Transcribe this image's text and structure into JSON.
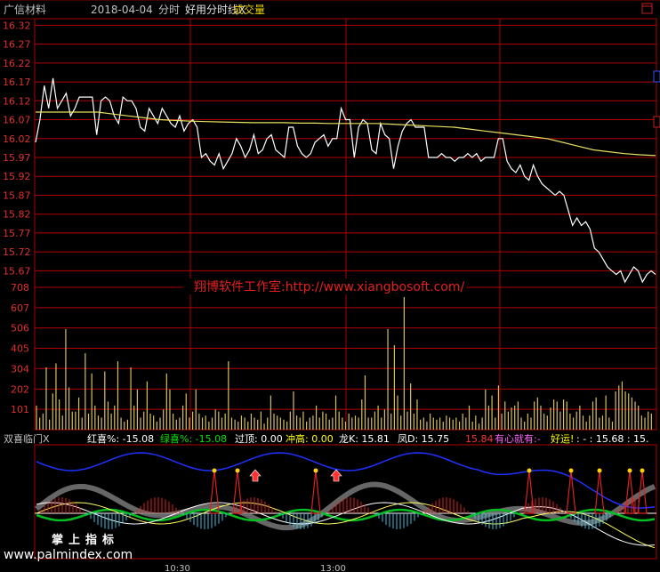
{
  "header": {
    "stock": "广信材料",
    "date": "2018-04-04",
    "mode": "分时",
    "indicator": "好用分时线X",
    "volume": "成交量"
  },
  "watermark": "翔博软件工作室:http://www.xiangbosoft.com/",
  "legend": {
    "title": "双喜临门X",
    "hongxi": "红喜%: -15.08",
    "lvxi": "绿喜%: -15.08",
    "guoding": "过顶: 0.00",
    "chonggao": "冲高: 0.00",
    "long": "龙K: 15.81",
    "feng": "凤D: 15.75",
    "red_value": "15.84",
    "youxin": "有心就有:-",
    "haoyun": "好运!",
    "tail": ": - : 15.68 : 15."
  },
  "footer": {
    "logo": "掌上指标",
    "site": "www.palmindex.com",
    "time1": "10:30",
    "time2": "13:00"
  },
  "colors": {
    "grid": "#b00000",
    "price_line": "#ffffff",
    "avg_line": "#e8e060",
    "volume_bar": "#d8c060",
    "axis_text": "#e03030",
    "indicator_blue": "#2030ff",
    "indicator_green": "#00c020",
    "indicator_red": "#e02020"
  },
  "chart_data": {
    "type": "line",
    "y_ticks": [
      "16.32",
      "16.27",
      "16.22",
      "16.17",
      "16.12",
      "16.07",
      "16.02",
      "15.97",
      "15.92",
      "15.87",
      "15.82",
      "15.77",
      "15.72",
      "15.67"
    ],
    "ylim": [
      15.645,
      16.335
    ],
    "volume_ticks": [
      "708",
      "607",
      "506",
      "405",
      "304",
      "202",
      "101"
    ],
    "volume_ylim": [
      0,
      708
    ],
    "price_series": [
      {
        "name": "price",
        "values": [
          16.01,
          16.07,
          16.16,
          16.1,
          16.18,
          16.1,
          16.12,
          16.14,
          16.08,
          16.1,
          16.13,
          16.13,
          16.13,
          16.13,
          16.03,
          16.12,
          16.13,
          16.12,
          16.08,
          16.06,
          16.13,
          16.12,
          16.12,
          16.1,
          16.05,
          16.04,
          16.1,
          16.08,
          16.06,
          16.1,
          16.08,
          16.06,
          16.05,
          16.08,
          16.04,
          16.06,
          16.07,
          16.05,
          15.97,
          15.98,
          15.96,
          15.95,
          15.98,
          15.94,
          15.96,
          15.98,
          16.02,
          16.0,
          15.97,
          15.99,
          16.03,
          15.98,
          15.99,
          16.02,
          16.03,
          15.99,
          15.98,
          15.97,
          16.05,
          16.05,
          16.0,
          15.98,
          15.97,
          15.98,
          16.01,
          16.02,
          16.03,
          16.0,
          16.02,
          16.02,
          16.1,
          16.07,
          16.07,
          15.97,
          16.05,
          16.07,
          16.06,
          15.99,
          15.98,
          16.06,
          16.03,
          16.02,
          15.94,
          16.0,
          16.04,
          16.06,
          16.07,
          16.05,
          16.05,
          16.05,
          15.97,
          15.97,
          15.97,
          15.98,
          15.97,
          15.97,
          15.96,
          15.97,
          15.97,
          15.98,
          15.97,
          15.98,
          15.96,
          15.97,
          15.97,
          15.97,
          16.02,
          16.02,
          15.96,
          15.94,
          15.93,
          15.95,
          15.92,
          15.91,
          15.95,
          15.92,
          15.9,
          15.89,
          15.88,
          15.87,
          15.88,
          15.87,
          15.83,
          15.79,
          15.81,
          15.79,
          15.8,
          15.78,
          15.73,
          15.72,
          15.7,
          15.68,
          15.67,
          15.66,
          15.67,
          15.64,
          15.66,
          15.68,
          15.67,
          15.64,
          15.66,
          15.67,
          15.66
        ]
      },
      {
        "name": "average",
        "values": [
          16.09,
          16.09,
          16.09,
          16.09,
          16.09,
          16.085,
          16.08,
          16.075,
          16.07,
          16.068,
          16.066,
          16.065,
          16.064,
          16.063,
          16.062,
          16.062,
          16.062,
          16.061,
          16.061,
          16.06,
          16.06,
          16.06,
          16.06,
          16.058,
          16.056,
          16.054,
          16.052,
          16.05,
          16.045,
          16.04,
          16.035,
          16.03,
          16.025,
          16.02,
          16.01,
          16.0,
          15.99,
          15.985,
          15.98,
          15.977,
          15.975
        ]
      }
    ],
    "volume_values": [
      120,
      60,
      80,
      310,
      50,
      180,
      330,
      150,
      70,
      500,
      210,
      90,
      90,
      160,
      60,
      380,
      80,
      280,
      120,
      70,
      60,
      290,
      140,
      80,
      120,
      340,
      60,
      40,
      50,
      310,
      120,
      200,
      60,
      90,
      240,
      80,
      70,
      40,
      60,
      100,
      280,
      200,
      80,
      50,
      60,
      120,
      180,
      60,
      90,
      200,
      80,
      60,
      70,
      40,
      60,
      100,
      90,
      60,
      80,
      340,
      60,
      50,
      40,
      70,
      60,
      40,
      80,
      60,
      50,
      90,
      30,
      60,
      170,
      80,
      70,
      60,
      50,
      40,
      90,
      190,
      70,
      60,
      90,
      40,
      60,
      70,
      120,
      60,
      90,
      80,
      50,
      60,
      170,
      90,
      60,
      40,
      80,
      60,
      70,
      60,
      150,
      270,
      60,
      60,
      90,
      120,
      60,
      100,
      500,
      80,
      420,
      170,
      70,
      660,
      90,
      230,
      80,
      150,
      50,
      60,
      40,
      80,
      60,
      50,
      60,
      40,
      70,
      60,
      50,
      60,
      40,
      80,
      60,
      120,
      40,
      70,
      30,
      60,
      200,
      120,
      170,
      60,
      220,
      80,
      140,
      90,
      110,
      120,
      140,
      60,
      40,
      80,
      60,
      140,
      160,
      120,
      80,
      70,
      110,
      150,
      140,
      90,
      150,
      140,
      80,
      60,
      90,
      120,
      70,
      40,
      70,
      140,
      160,
      60,
      70,
      170,
      60,
      40,
      190,
      220,
      240,
      190,
      180,
      160,
      140,
      120,
      70,
      60,
      90,
      80
    ]
  }
}
